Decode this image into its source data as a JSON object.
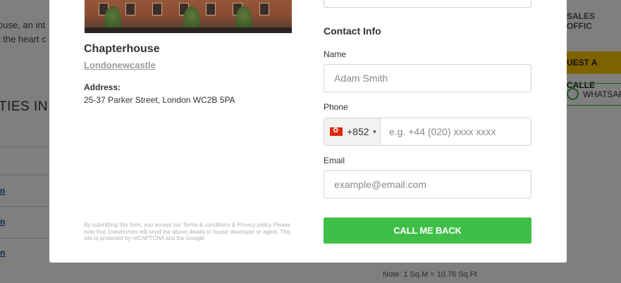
{
  "background": {
    "intro_line1": "ouse, an int",
    "intro_line2": "t the heart c",
    "section_heading": "TIES IN T",
    "row_links": [
      "n",
      "n",
      "n"
    ],
    "sales_office": "SALES OFFIC",
    "request_callback": "UEST A CALLE",
    "whatsapp": "WHATSAP",
    "note": "Note: 1 Sq.M = 10.76 Sq.Ft"
  },
  "property": {
    "name": "Chapterhouse",
    "developer": "Londonewcastle",
    "address_label": "Address:",
    "address": "25-37 Parker Street, London WC2B 5PA"
  },
  "form": {
    "section_title": "Contact Info",
    "name_label": "Name",
    "name_placeholder": "Adam Smith",
    "phone_label": "Phone",
    "dial_code": "+852",
    "phone_placeholder": "e.g. +44 (020) xxxx xxxx",
    "email_label": "Email",
    "email_placeholder": "example@email.com",
    "submit_label": "CALL ME BACK",
    "disclaimer": "By submitting this form, you accept our Terms & conditions & Privacy policy Please note that 1newhomes will send the above details to house developer or agent. This site is protected by reCAPTCHA and the Google."
  },
  "colors": {
    "submit": "#3fbf48",
    "request_button": "#ffc400",
    "whatsapp": "#3bb44a"
  }
}
